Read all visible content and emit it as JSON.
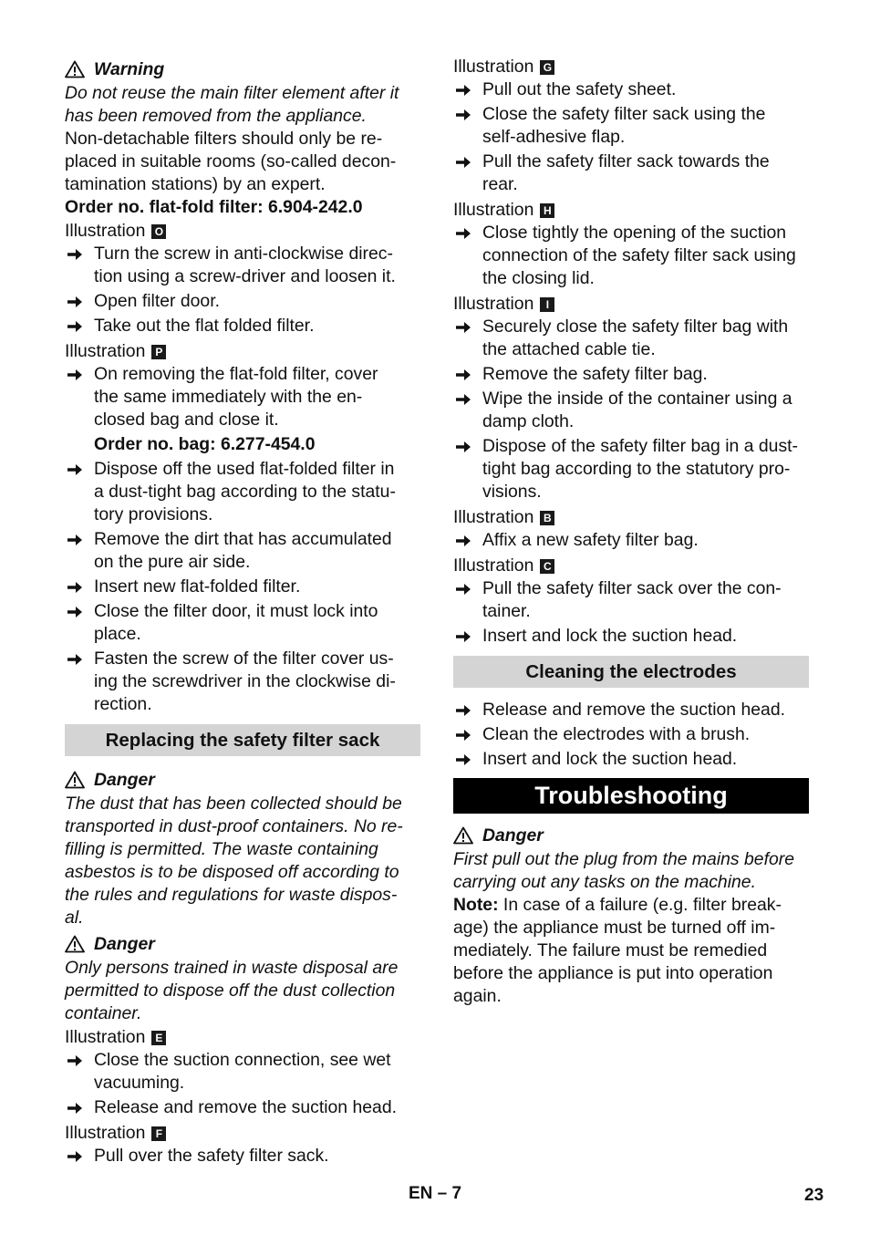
{
  "left_column": {
    "warning": {
      "label": "Warning",
      "icon": "warning-triangle-icon",
      "italic_lines": [
        "Do not reuse the main filter element after it",
        "has been removed from the appliance."
      ],
      "body_lines": [
        "Non-detachable filters should only be re-",
        "placed in suitable rooms (so-called decon-",
        "tamination stations) by an expert."
      ]
    },
    "order_filter": "Order no. flat-fold filter: 6.904-242.0",
    "illustration_o": {
      "label": "Illustration",
      "badge": "O"
    },
    "steps_o": [
      {
        "lines": [
          "Turn the screw in anti-clockwise direc-",
          "tion using a screw-driver and loosen it."
        ]
      },
      {
        "lines": [
          "Open filter door."
        ]
      },
      {
        "lines": [
          "Take out the flat folded filter."
        ]
      }
    ],
    "illustration_p": {
      "label": "Illustration",
      "badge": "P"
    },
    "steps_p1": [
      {
        "lines": [
          "On removing the flat-fold filter, cover",
          "the same immediately with the en-",
          "closed bag and close it."
        ]
      }
    ],
    "order_bag": "Order no. bag: 6.277-454.0",
    "steps_p2": [
      {
        "lines": [
          "Dispose off the used flat-folded filter in",
          "a dust-tight bag according to the statu-",
          "tory provisions."
        ]
      },
      {
        "lines": [
          "Remove the dirt that has accumulated",
          "on the pure air side."
        ]
      },
      {
        "lines": [
          "Insert new flat-folded filter."
        ]
      },
      {
        "lines": [
          "Close the filter door, it must lock into",
          "place."
        ]
      },
      {
        "lines": [
          "Fasten the screw of the filter cover us-",
          "ing the screwdriver in the clockwise di-",
          "rection."
        ]
      }
    ],
    "section_safety_sack": "Replacing the safety filter sack",
    "danger1": {
      "label": "Danger",
      "icon": "warning-triangle-icon",
      "italic_lines": [
        "The dust that has been collected should be",
        "transported in dust-proof containers. No re-",
        "filling is permitted. The waste containing",
        "asbestos is to be disposed off according to",
        "the rules and regulations for waste dispos-",
        "al."
      ]
    },
    "danger2": {
      "label": "Danger",
      "icon": "warning-triangle-icon",
      "italic_lines": [
        "Only persons trained in waste disposal are",
        "permitted to dispose off the dust collection",
        "container."
      ]
    },
    "illustration_e": {
      "label": "Illustration",
      "badge": "E"
    },
    "steps_e": [
      {
        "lines": [
          "Close the suction connection, see wet",
          "vacuuming."
        ]
      },
      {
        "lines": [
          "Release and remove the suction head."
        ]
      }
    ],
    "illustration_f": {
      "label": "Illustration",
      "badge": "F"
    },
    "steps_f": [
      {
        "lines": [
          "Pull over the safety filter sack."
        ]
      }
    ]
  },
  "right_column": {
    "illustration_g": {
      "label": "Illustration",
      "badge": "G"
    },
    "steps_g": [
      {
        "lines": [
          "Pull out the safety sheet."
        ]
      },
      {
        "lines": [
          "Close the safety filter sack using the",
          "self-adhesive flap."
        ]
      },
      {
        "lines": [
          "Pull the safety filter sack towards the",
          "rear."
        ]
      }
    ],
    "illustration_h": {
      "label": "Illustration",
      "badge": "H"
    },
    "steps_h": [
      {
        "lines": [
          "Close tightly the opening of the suction",
          "connection of the safety filter sack using",
          "the closing lid."
        ]
      }
    ],
    "illustration_i": {
      "label": "Illustration",
      "badge": "I"
    },
    "steps_i": [
      {
        "lines": [
          "Securely close the safety filter bag with",
          "the attached cable tie."
        ]
      },
      {
        "lines": [
          "Remove the safety filter bag."
        ]
      },
      {
        "lines": [
          "Wipe the inside of the container using a",
          "damp cloth."
        ]
      },
      {
        "lines": [
          "Dispose of the safety filter bag in a dust-",
          "tight bag according to the statutory pro-",
          "visions."
        ]
      }
    ],
    "illustration_b": {
      "label": "Illustration",
      "badge": "B"
    },
    "steps_b": [
      {
        "lines": [
          "Affix a new safety filter bag."
        ]
      }
    ],
    "illustration_c": {
      "label": "Illustration",
      "badge": "C"
    },
    "steps_c": [
      {
        "lines": [
          "Pull the safety filter sack over the con-",
          "tainer."
        ]
      },
      {
        "lines": [
          "Insert and lock the suction head."
        ]
      }
    ],
    "section_electrodes": "Cleaning the electrodes",
    "steps_electrodes": [
      {
        "lines": [
          "Release and remove the suction head."
        ]
      },
      {
        "lines": [
          "Clean the electrodes with a brush."
        ]
      },
      {
        "lines": [
          "Insert and lock the suction head."
        ]
      }
    ],
    "chapter_troubleshooting": "Troubleshooting",
    "danger3": {
      "label": "Danger",
      "icon": "warning-triangle-icon",
      "italic_lines": [
        "First pull out the plug from the mains before",
        "carrying out any tasks on the machine."
      ]
    },
    "note": {
      "label": "Note:",
      "first_line_rest": " In case of a failure (e.g. filter break-",
      "lines": [
        "age) the appliance must be turned off im-",
        "mediately. The failure must be remedied",
        "before the appliance is put into operation",
        "again."
      ]
    }
  },
  "footer": {
    "section_code": "EN – 7",
    "page_number": "23"
  },
  "icons": {
    "step_bullet": "arrow-right-icon",
    "warning": "warning-triangle-icon"
  }
}
